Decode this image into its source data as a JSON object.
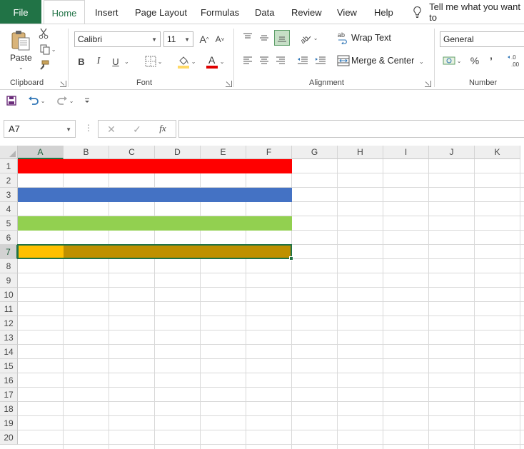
{
  "tabs": {
    "file": "File",
    "home": "Home",
    "insert": "Insert",
    "page_layout": "Page Layout",
    "formulas": "Formulas",
    "data": "Data",
    "review": "Review",
    "view": "View",
    "help": "Help",
    "tell_me": "Tell me what you want to"
  },
  "ribbon": {
    "clipboard": {
      "paste_label": "Paste",
      "group_label": "Clipboard"
    },
    "font": {
      "font_name": "Calibri",
      "font_size": "11",
      "bold": "B",
      "italic": "I",
      "underline": "U",
      "grow": "A",
      "shrink": "A",
      "group_label": "Font"
    },
    "alignment": {
      "wrap_text": "Wrap Text",
      "merge_center": "Merge & Center",
      "group_label": "Alignment"
    },
    "number": {
      "format": "General",
      "percent": "%",
      "comma": "’",
      "group_label": "Number"
    }
  },
  "formula_bar": {
    "name_box": "A7",
    "fx": "fx",
    "formula": ""
  },
  "grid": {
    "columns": [
      "A",
      "B",
      "C",
      "D",
      "E",
      "F",
      "G",
      "H",
      "I",
      "J",
      "K"
    ],
    "rows": [
      "1",
      "2",
      "3",
      "4",
      "5",
      "6",
      "7",
      "8",
      "9",
      "10",
      "11",
      "12",
      "13",
      "14",
      "15",
      "16",
      "17",
      "18",
      "19",
      "20"
    ],
    "selected_cell": "A7",
    "row_fills": [
      {
        "row": 1,
        "range": "A1:F1",
        "color": "#ff0000"
      },
      {
        "row": 3,
        "range": "A3:F3",
        "color": "#4472c4"
      },
      {
        "row": 5,
        "range": "A5:F5",
        "color": "#92d050"
      },
      {
        "row": 7,
        "range": "A7",
        "color": "#ffc000"
      },
      {
        "row": 7,
        "range": "B7:F7",
        "color": "#bf9000"
      }
    ]
  },
  "colors": {
    "accent": "#217346"
  }
}
